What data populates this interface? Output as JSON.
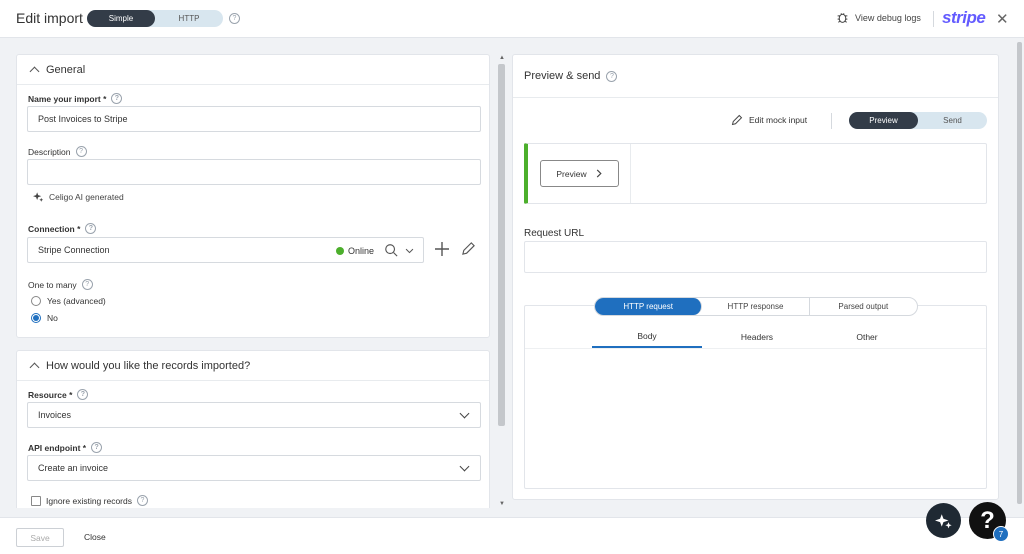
{
  "header": {
    "title": "Edit import",
    "mode_tabs": [
      "Simple",
      "HTTP"
    ],
    "debug_label": "View debug logs",
    "brand": "stripe"
  },
  "general": {
    "section_title": "General",
    "name_label": "Name your import *",
    "name_value": "Post Invoices to Stripe",
    "description_label": "Description",
    "description_value": "",
    "ai_label": "Celigo AI generated",
    "connection_label": "Connection *",
    "connection_value": "Stripe Connection",
    "connection_status": "Online",
    "one_to_many_label": "One to many",
    "options": [
      "Yes (advanced)",
      "No"
    ]
  },
  "records": {
    "section_title": "How would you like the records imported?",
    "resource_label": "Resource *",
    "resource_value": "Invoices",
    "endpoint_label": "API endpoint *",
    "endpoint_value": "Create an invoice",
    "ignore_label": "Ignore existing records"
  },
  "preview": {
    "title": "Preview & send",
    "edit_mock": "Edit mock input",
    "mode_tabs": [
      "Preview",
      "Send"
    ],
    "preview_button": "Preview",
    "request_url_label": "Request URL",
    "request_url_value": "",
    "http_tabs": [
      "HTTP request",
      "HTTP response",
      "Parsed output"
    ],
    "sub_tabs": [
      "Body",
      "Headers",
      "Other"
    ]
  },
  "footer": {
    "save": "Save",
    "close": "Close"
  },
  "floating": {
    "help": "?",
    "badge": "7"
  },
  "colors": {
    "accent": "#1f6fbf",
    "online": "#4caf2c",
    "dark": "#333c48",
    "brand": "#635bff"
  }
}
